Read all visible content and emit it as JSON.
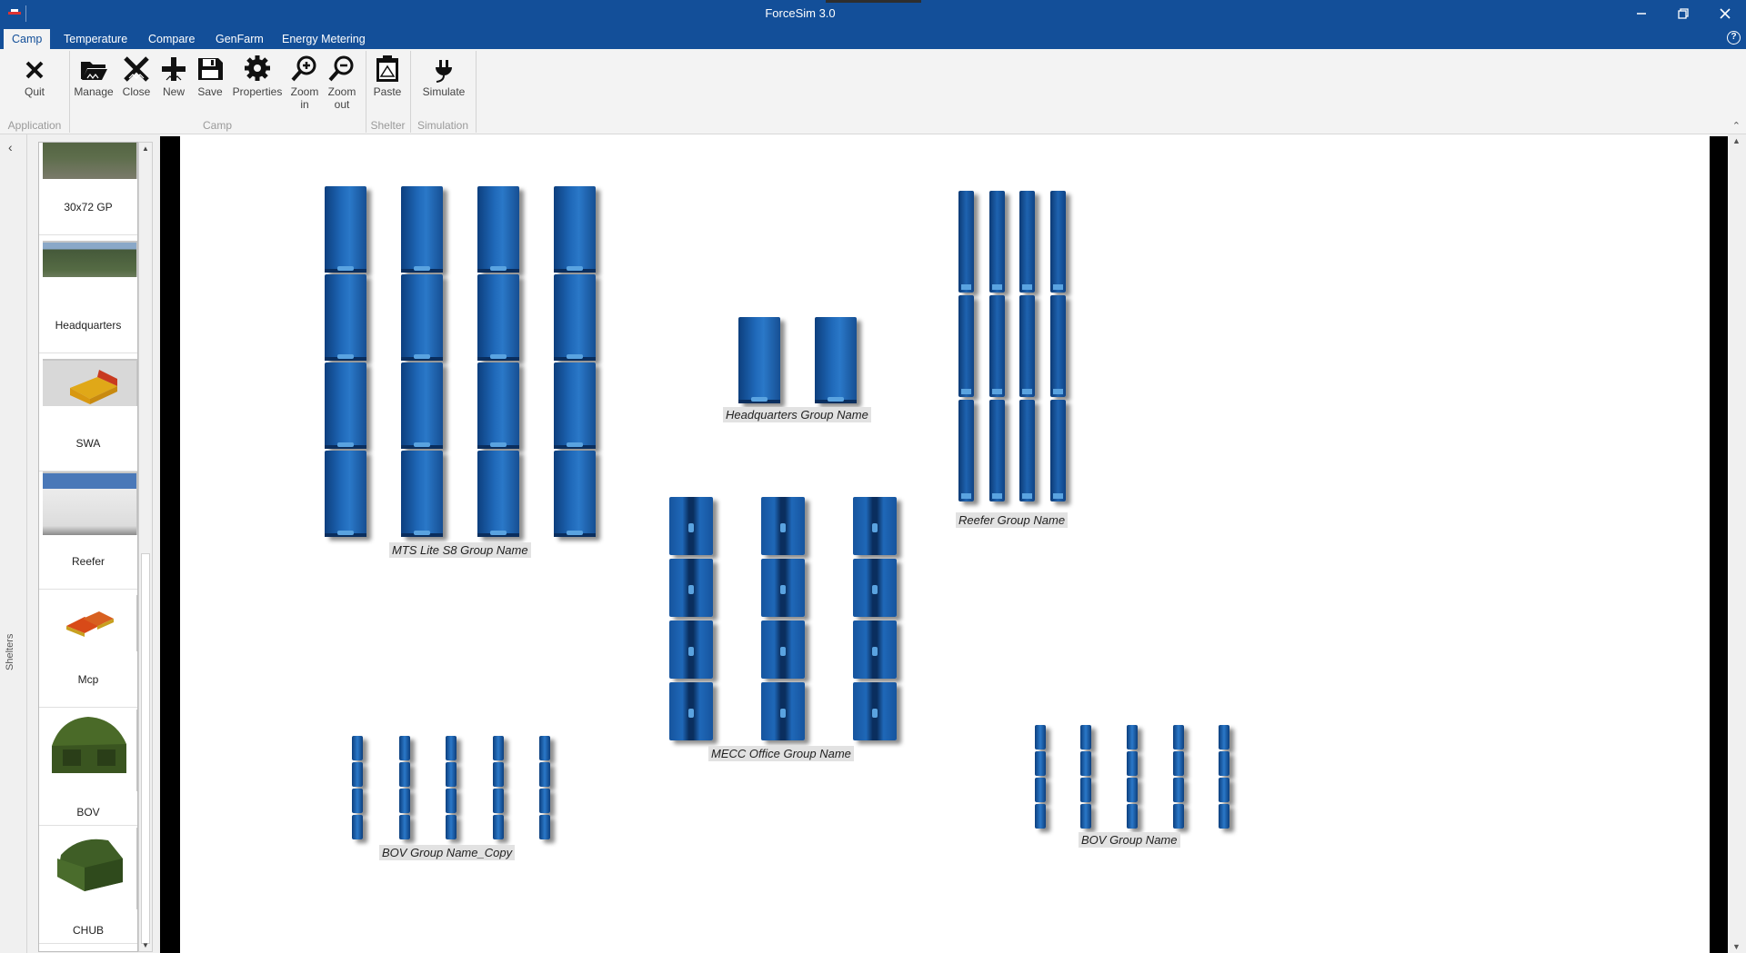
{
  "window": {
    "title": "ForceSim 3.0"
  },
  "menu": {
    "tabs": [
      "Camp",
      "Temperature",
      "Compare",
      "GenFarm",
      "Energy Metering"
    ],
    "help_label": "?"
  },
  "ribbon": {
    "buttons": {
      "quit": "Quit",
      "manage": "Manage",
      "close": "Close",
      "new": "New",
      "save": "Save",
      "properties": "Properties",
      "zoom_in_1": "Zoom",
      "zoom_in_2": "in",
      "zoom_out_1": "Zoom",
      "zoom_out_2": "out",
      "paste": "Paste",
      "simulate": "Simulate"
    },
    "groups": {
      "application": "Application",
      "camp": "Camp",
      "shelter": "Shelter",
      "simulation": "Simulation"
    }
  },
  "sidepanel": {
    "label": "Shelters",
    "items": [
      "30x72 GP",
      "Headquarters",
      "SWA",
      "Reefer",
      "Mcp",
      "BOV",
      "CHUB"
    ]
  },
  "canvas": {
    "groups": {
      "mts": "MTS Lite S8 Group Name",
      "hq": "Headquarters Group Name",
      "reefer": "Reefer Group Name",
      "mecc": "MECC Office Group Name",
      "bov_copy": "BOV Group Name_Copy",
      "bov": "BOV Group Name"
    }
  },
  "colors": {
    "titlebar": "#134f99",
    "ribbon": "#f3f3f3",
    "unit_blue": "#1f68b8"
  }
}
